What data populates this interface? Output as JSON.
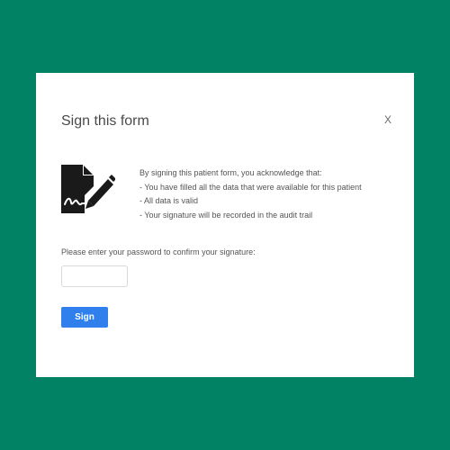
{
  "dialog": {
    "title": "Sign this form",
    "close_label": "X"
  },
  "icon": {
    "name": "document-signature-icon"
  },
  "acknowledgement": {
    "intro": "By signing this patient form, you acknowledge that:",
    "items": [
      "- You have filled all the data that were available for this patient",
      "- All data is valid",
      "- Your signature will be recorded in the audit trail"
    ]
  },
  "password": {
    "label": "Please enter your password to confirm your signature:",
    "value": "",
    "placeholder": ""
  },
  "sign_button": {
    "label": "Sign"
  },
  "colors": {
    "background": "#018265",
    "button": "#2f80ed",
    "panel": "#ffffff"
  }
}
